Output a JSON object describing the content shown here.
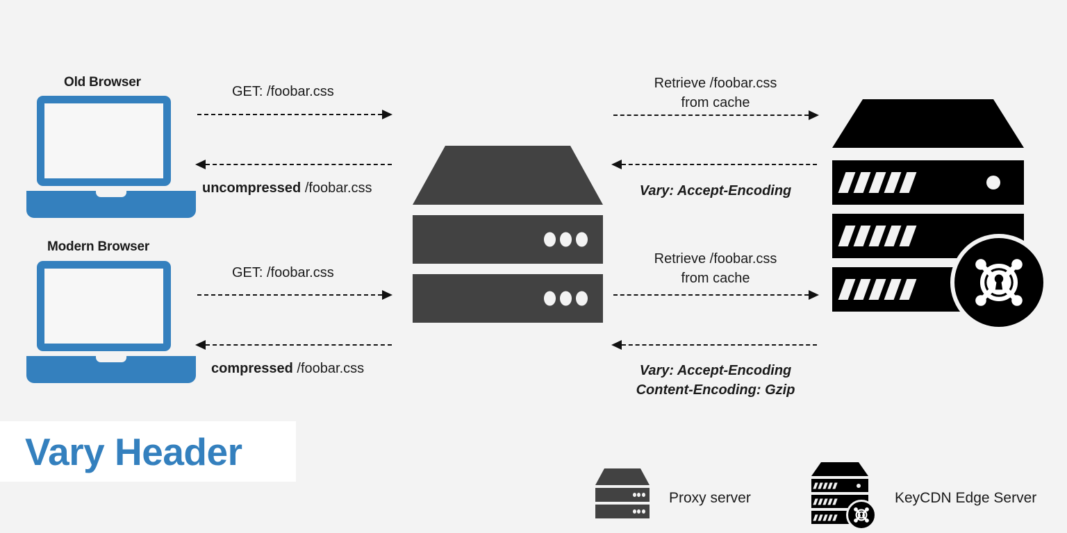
{
  "title": {
    "text": "Vary Header",
    "color": "#3480be",
    "box_background": "#ffffff"
  },
  "background_color": "#f3f3f3",
  "colors": {
    "browser_blue": "#3480be",
    "proxy_gray": "#424242",
    "edge_black": "#000000",
    "text": "#1a1a1a"
  },
  "nodes": {
    "old_browser": {
      "label": "Old Browser",
      "icon": "laptop-icon"
    },
    "modern_browser": {
      "label": "Modern Browser",
      "icon": "laptop-icon"
    },
    "proxy": {
      "icon": "proxy-server-icon"
    },
    "edge": {
      "icon": "keycdn-edge-server-icon"
    }
  },
  "flows": [
    {
      "id": "old-request",
      "direction": "right",
      "label_above": "GET: /foobar.css",
      "label_below": ""
    },
    {
      "id": "old-response",
      "direction": "left",
      "label_above": "",
      "label_below_bold": "uncompressed",
      "label_below_rest": " /foobar.css"
    },
    {
      "id": "modern-request",
      "direction": "right",
      "label_above": "GET: /foobar.css",
      "label_below": ""
    },
    {
      "id": "modern-response",
      "direction": "left",
      "label_above": "",
      "label_below_bold": "compressed",
      "label_below_rest": " /foobar.css"
    },
    {
      "id": "proxy-to-edge-top",
      "direction": "right",
      "label_above_line1": "Retrieve /foobar.css",
      "label_above_line2": "from cache"
    },
    {
      "id": "edge-to-proxy-top",
      "direction": "left",
      "label_below_line1": "Vary: Accept-Encoding"
    },
    {
      "id": "proxy-to-edge-bottom",
      "direction": "right",
      "label_above_line1": "Retrieve /foobar.css",
      "label_above_line2": "from cache"
    },
    {
      "id": "edge-to-proxy-bottom",
      "direction": "left",
      "label_below_line1": "Vary: Accept-Encoding",
      "label_below_line2": "Content-Encoding: Gzip"
    }
  ],
  "legend": [
    {
      "icon": "proxy-server-icon",
      "label": "Proxy server"
    },
    {
      "icon": "keycdn-edge-server-icon",
      "label": "KeyCDN Edge Server"
    }
  ]
}
